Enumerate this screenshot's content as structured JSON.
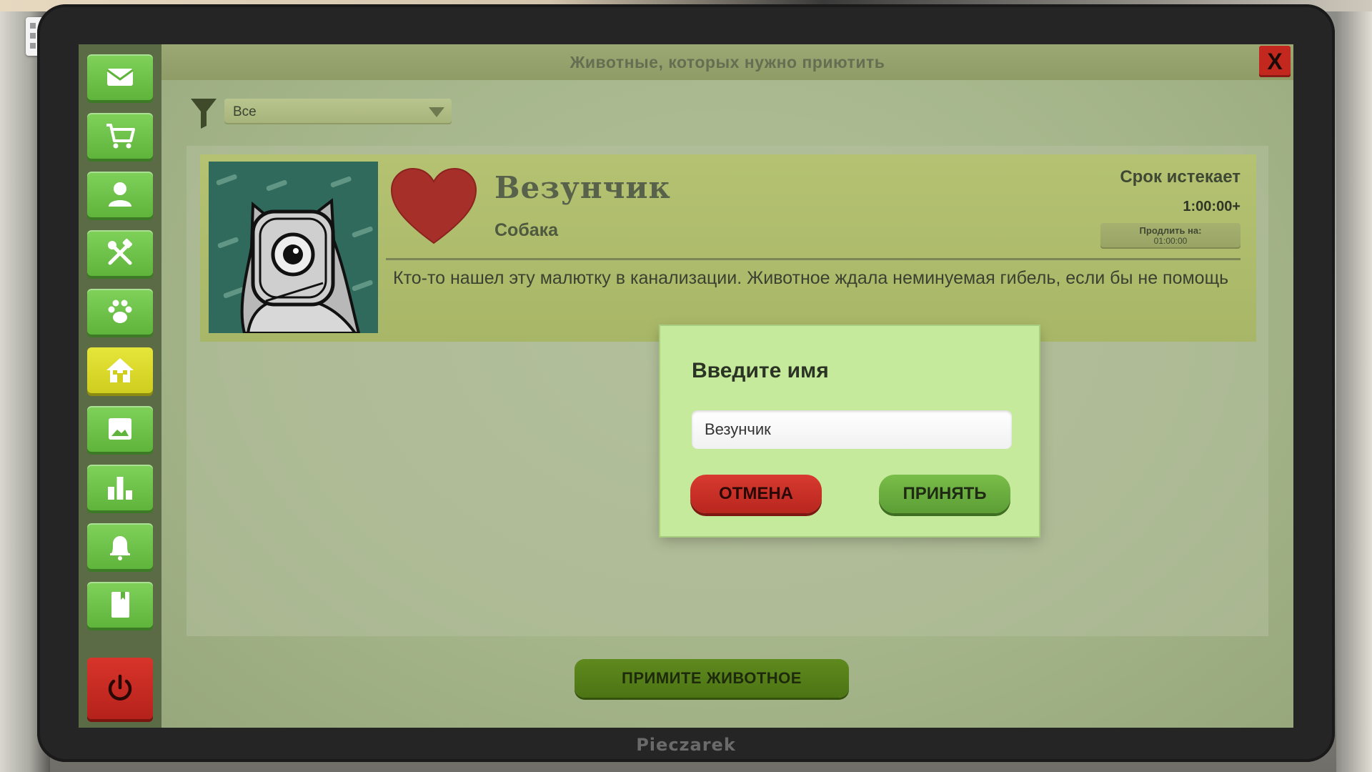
{
  "window": {
    "title": "Животные, которых нужно приютить",
    "close_label": "X"
  },
  "filter": {
    "selected": "Все"
  },
  "sidebar": {
    "items": [
      {
        "name": "mail",
        "icon": "envelope-icon"
      },
      {
        "name": "shop",
        "icon": "cart-icon"
      },
      {
        "name": "profile",
        "icon": "person-icon"
      },
      {
        "name": "tools",
        "icon": "tools-icon"
      },
      {
        "name": "animals",
        "icon": "paw-icon"
      },
      {
        "name": "adoption",
        "icon": "house-icon",
        "active": true
      },
      {
        "name": "gallery",
        "icon": "image-icon"
      },
      {
        "name": "stats",
        "icon": "bar-chart-icon"
      },
      {
        "name": "notifications",
        "icon": "bell-icon"
      },
      {
        "name": "journal",
        "icon": "book-icon"
      },
      {
        "name": "power",
        "icon": "power-icon"
      }
    ]
  },
  "animal_card": {
    "name": "Везунчик",
    "type": "Собака",
    "expires_label": "Срок истекает",
    "expires_time": "1:00:00+",
    "extend_label": "Продлить на:",
    "extend_time": "01:00:00",
    "description": "Кто-то нашел эту малютку в канализации. Животное ждала неминуемая гибель, если бы не помощь"
  },
  "name_dialog": {
    "title": "Введите имя",
    "input_value": "Везунчик",
    "cancel_label": "ОТМЕНА",
    "accept_label": "ПРИНЯТЬ"
  },
  "footer": {
    "accept_animal_label": "ПРИМИТЕ ЖИВОТНОЕ"
  },
  "monitor": {
    "brand": "Pieczarek"
  },
  "colors": {
    "accent_green": "#5fb43c",
    "active_yellow": "#cfcd1e",
    "danger_red": "#c3281f",
    "modal_bg": "#c6ea9b"
  }
}
